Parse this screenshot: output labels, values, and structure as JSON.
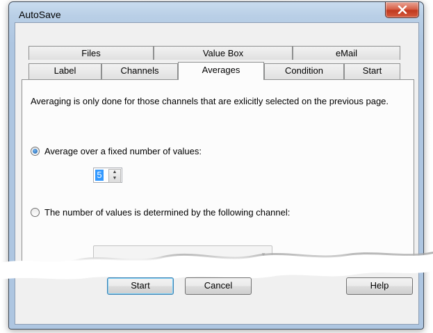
{
  "window": {
    "title": "AutoSave",
    "close_icon": "close-x-icon"
  },
  "tabs": {
    "row_back": [
      "Files",
      "Value Box",
      "eMail"
    ],
    "row_front": [
      "Label",
      "Channels",
      "Averages",
      "Condition",
      "Start"
    ],
    "active": "Averages"
  },
  "panel": {
    "description": "Averaging is only done for those channels that are exlicitly selected on the previous page.",
    "option_fixed_label": "Average over a fixed number of values:",
    "option_fixed_selected": true,
    "count_value": "5",
    "option_channel_label": "The number of values is determined by the following channel:",
    "option_channel_selected": false,
    "channel_select_value": ""
  },
  "buttons": {
    "start": "Start",
    "cancel": "Cancel",
    "help": "Help"
  },
  "colors": {
    "accent": "#3399ff",
    "close": "#c0391f"
  }
}
